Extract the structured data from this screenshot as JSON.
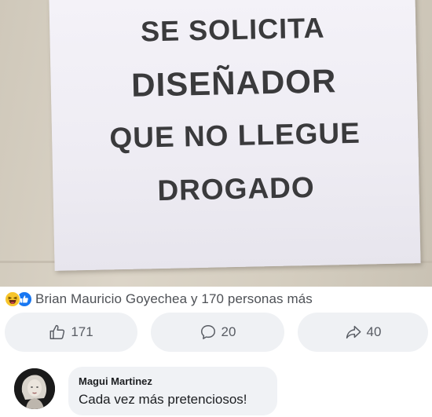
{
  "post": {
    "sign_lines": [
      "SE SOLICITA",
      "DISEÑADOR",
      "QUE NO LLEGUE",
      "DROGADO"
    ]
  },
  "reactions": {
    "icons": [
      "haha-reaction-icon",
      "like-reaction-icon"
    ],
    "summary": "Brian Mauricio Goyechea y 170 personas más"
  },
  "actions": {
    "like_count": "171",
    "comment_count": "20",
    "share_count": "40",
    "icons": [
      "thumbs-up-icon",
      "comment-bubble-icon",
      "share-arrow-icon"
    ]
  },
  "comment": {
    "author": "Magui Martinez",
    "text": "Cada vez más pretenciosos!"
  },
  "colors": {
    "like_blue": "#1877f2",
    "haha_yellow": "#f7c52b",
    "pill_bg": "#eff1f4",
    "bubble_bg": "#f0f2f5"
  }
}
